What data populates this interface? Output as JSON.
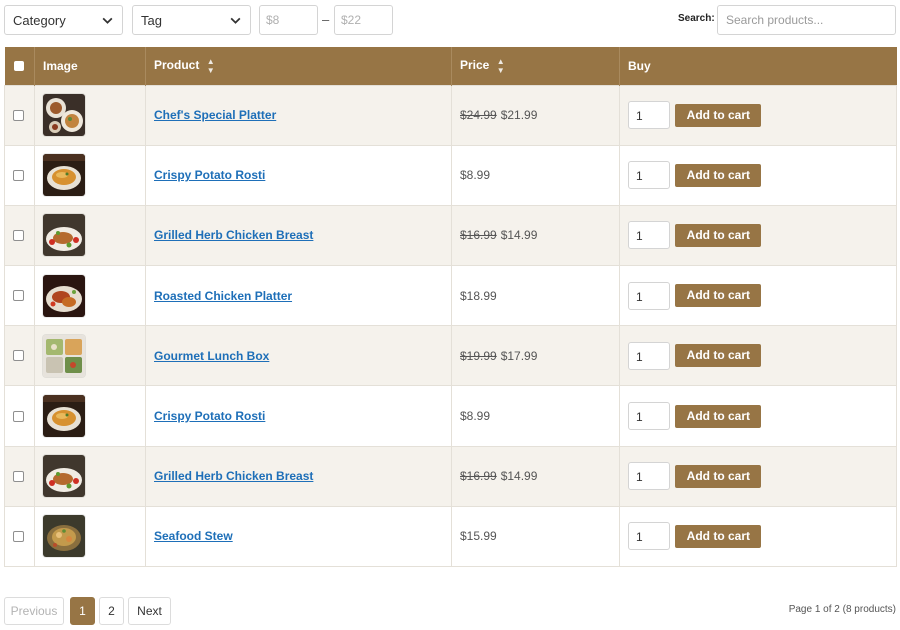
{
  "filters": {
    "category_label": "Category",
    "tag_label": "Tag",
    "price_min_placeholder": "$8",
    "price_max_placeholder": "$22",
    "range_separator": "–",
    "search_label": "Search:",
    "search_placeholder": "Search products..."
  },
  "table": {
    "headers": {
      "image": "Image",
      "product": "Product",
      "price": "Price",
      "buy": "Buy"
    },
    "add_to_cart_label": "Add to cart",
    "rows": [
      {
        "name": "Chef's Special Platter",
        "old_price": "$24.99",
        "price": "$21.99",
        "qty": "1",
        "thumb": "platter"
      },
      {
        "name": "Crispy Potato Rosti",
        "old_price": "",
        "price": "$8.99",
        "qty": "1",
        "thumb": "rosti"
      },
      {
        "name": "Grilled Herb Chicken Breast",
        "old_price": "$16.99",
        "price": "$14.99",
        "qty": "1",
        "thumb": "chicken"
      },
      {
        "name": "Roasted Chicken Platter",
        "old_price": "",
        "price": "$18.99",
        "qty": "1",
        "thumb": "roasted"
      },
      {
        "name": "Gourmet Lunch Box",
        "old_price": "$19.99",
        "price": "$17.99",
        "qty": "1",
        "thumb": "lunchbox"
      },
      {
        "name": "Crispy Potato Rosti",
        "old_price": "",
        "price": "$8.99",
        "qty": "1",
        "thumb": "rosti"
      },
      {
        "name": "Grilled Herb Chicken Breast",
        "old_price": "$16.99",
        "price": "$14.99",
        "qty": "1",
        "thumb": "chicken"
      },
      {
        "name": "Seafood Stew",
        "old_price": "",
        "price": "$15.99",
        "qty": "1",
        "thumb": "stew"
      }
    ]
  },
  "pagination": {
    "previous_label": "Previous",
    "pages": [
      "1",
      "2"
    ],
    "current_page": "1",
    "next_label": "Next",
    "info": "Page 1 of 2 (8 products)"
  },
  "colors": {
    "accent": "#977545",
    "link": "#1e6fb8",
    "row_alt": "#f5f2ec"
  },
  "icons": {
    "dropdown": "chevron-down-icon",
    "sort": "sort-icon"
  }
}
